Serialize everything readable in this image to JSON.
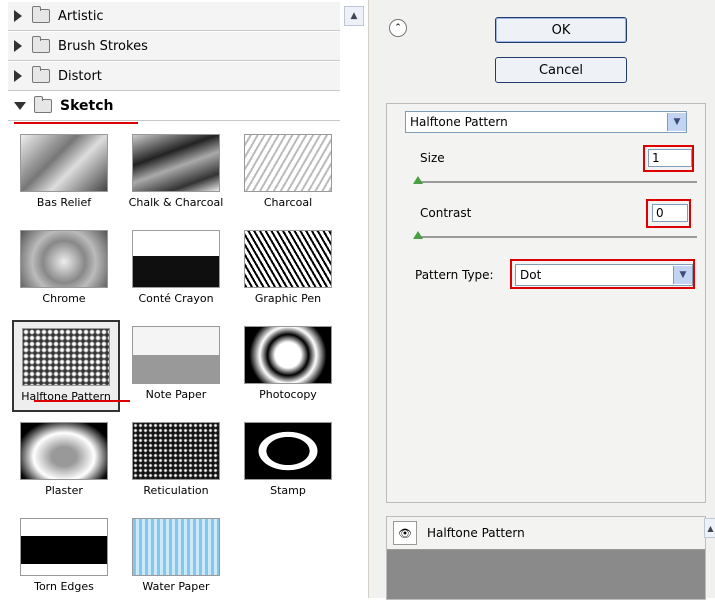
{
  "categories": [
    {
      "label": "Artistic",
      "expanded": false
    },
    {
      "label": "Brush Strokes",
      "expanded": false
    },
    {
      "label": "Distort",
      "expanded": false
    },
    {
      "label": "Sketch",
      "expanded": true
    }
  ],
  "thumbnails": [
    {
      "label": "Bas Relief"
    },
    {
      "label": "Chalk & Charcoal"
    },
    {
      "label": "Charcoal"
    },
    {
      "label": "Chrome"
    },
    {
      "label": "Conté Crayon"
    },
    {
      "label": "Graphic Pen"
    },
    {
      "label": "Halftone Pattern",
      "selected": true
    },
    {
      "label": "Note Paper"
    },
    {
      "label": "Photocopy"
    },
    {
      "label": "Plaster"
    },
    {
      "label": "Reticulation"
    },
    {
      "label": "Stamp"
    },
    {
      "label": "Torn Edges"
    },
    {
      "label": "Water Paper"
    }
  ],
  "buttons": {
    "ok": "OK",
    "cancel": "Cancel"
  },
  "filter_select": {
    "value": "Halftone Pattern"
  },
  "size": {
    "label": "Size",
    "value": "1"
  },
  "contrast": {
    "label": "Contrast",
    "value": "0"
  },
  "pattern_type": {
    "label": "Pattern Type:",
    "value": "Dot"
  },
  "layer": {
    "name": "Halftone Pattern"
  },
  "colors": {
    "highlight": "#dd0000",
    "selection_accent": "#49a042",
    "dropdown_arrow_bg": "#c3d3f2"
  }
}
